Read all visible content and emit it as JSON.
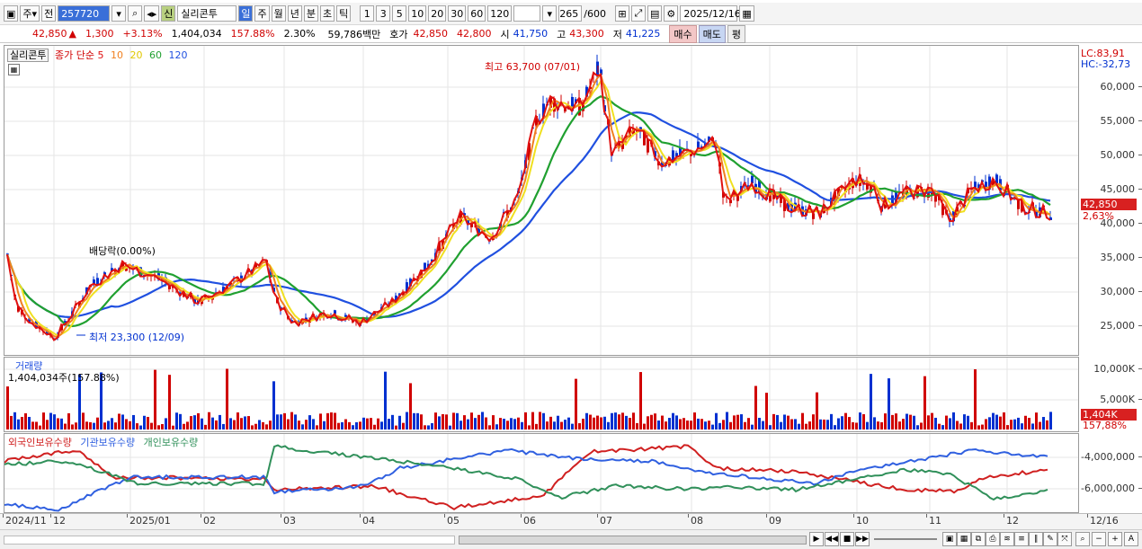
{
  "toolbar": {
    "period_type": "주",
    "prev_label": "전",
    "code_value": "257720",
    "stock_badge": "신",
    "stock_name": "실리콘투",
    "intervals": [
      "일",
      "주",
      "월",
      "년",
      "분",
      "초",
      "틱"
    ],
    "active_interval": "일",
    "numbers": [
      "1",
      "3",
      "5",
      "10",
      "20",
      "30",
      "60",
      "120"
    ],
    "count_value": "265",
    "count_max": "/600",
    "date_value": "2025/12/16"
  },
  "quote": {
    "price": "42,850",
    "change_arrow": "▲",
    "change": "1,300",
    "change_pct": "+3.13%",
    "volume": "1,404,034",
    "volume_ratio": "157.88%",
    "turnover_pct": "2.30%",
    "amount": "59,786백만",
    "bid_label": "호가",
    "ask_price": "42,850",
    "bid_price": "42,800",
    "open_label": "시",
    "open": "41,750",
    "high_label": "고",
    "high": "43,300",
    "low_label": "저",
    "low": "41,225",
    "buy_label": "매수",
    "sell_label": "매도",
    "eval_label": "평"
  },
  "price_panel": {
    "stock_label": "실리콘투",
    "legend_prefix": "종가 단순",
    "ma_labels": [
      "5",
      "10",
      "20",
      "60",
      "120"
    ],
    "lc_label": "LC:83,91",
    "hc_label": "HC:-32,73",
    "y_ticks": [
      "60,000",
      "55,000",
      "50,000",
      "45,000",
      "40,000",
      "35,000",
      "30,000",
      "25,000"
    ],
    "current_price_tag": "42,850",
    "current_pct_tag": "2,63%",
    "high_annotation": "최고 63,700 (07/01)",
    "low_annotation": "최저 23,300 (12/09)",
    "dividend_annotation": "배당락(0.00%)"
  },
  "volume_panel": {
    "title": "거래량",
    "subtitle": "1,404,034주(157.88%)",
    "y_ticks": [
      "10,000K",
      "5,000K"
    ],
    "current_tag": "1,404K",
    "current_pct_tag": "157,88%"
  },
  "holdings_panel": {
    "legend": [
      "외국인보유수량",
      "기관보유수량",
      "개인보유수량"
    ],
    "y_ticks": [
      "-4,000,000",
      "-6,000,000"
    ]
  },
  "date_axis": {
    "labels": [
      "2024/11",
      "12",
      "2025/01",
      "02",
      "03",
      "04",
      "05",
      "06",
      "07",
      "08",
      "09",
      "10",
      "11",
      "12",
      "12/16"
    ]
  },
  "colors": {
    "up": "#d00000",
    "down": "#0030d0",
    "ma5": "#e01010",
    "ma10": "#f08020",
    "ma20": "#f0e020",
    "ma60": "#20a030",
    "ma120": "#2050e0",
    "foreign": "#d02020",
    "institution": "#3060e0",
    "individual": "#30905a"
  }
}
